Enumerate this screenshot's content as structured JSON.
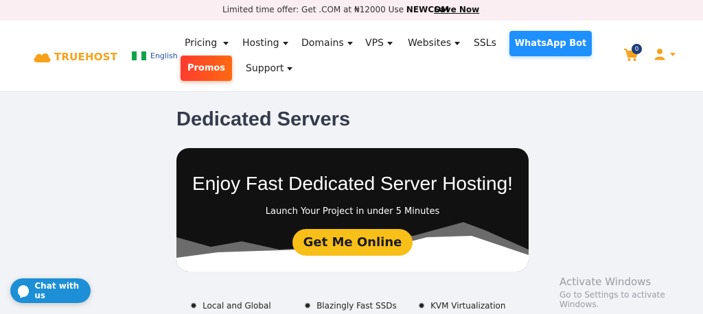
{
  "promo_bar": {
    "text": "Limited time offer: Get .COM at ₦12000 Use ",
    "code": "NEWCOM",
    "link": "Save Now"
  },
  "header": {
    "logo_text": "TRUEHOST",
    "language": "English",
    "nav": {
      "pricing": "Pricing",
      "hosting": "Hosting",
      "domains": "Domains",
      "vps": "VPS",
      "websites": "Websites",
      "ssls": "SSLs",
      "whatsapp_bot": "WhatsApp Bot",
      "promos": "Promos",
      "support": "Support"
    },
    "cart_count": "0"
  },
  "page": {
    "title": "Dedicated Servers"
  },
  "hero": {
    "title": "Enjoy Fast Dedicated Server Hosting!",
    "subtitle": "Launch Your Project in under 5 Minutes",
    "cta": "Get Me Online"
  },
  "features": [
    {
      "label": "Local and Global"
    },
    {
      "label": "Blazingly Fast SSDs"
    },
    {
      "label": "KVM Virtualization"
    }
  ],
  "chat": {
    "label": "Chat with us"
  },
  "watermark": {
    "line1": "Activate Windows",
    "line2": "Go to Settings to activate Windows."
  },
  "colors": {
    "brand_orange": "#f7a21b",
    "whatsapp_button": "#1e90ff",
    "promos_button": "#ff4a24",
    "cta_yellow": "#f8bf18",
    "chat_blue": "#1c8fd6"
  }
}
